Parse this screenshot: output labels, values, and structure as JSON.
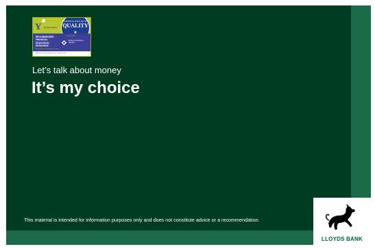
{
  "badge": {
    "brand": "Y",
    "brand_sub": "young money",
    "seal_top": "FINANCIAL EDUCATION",
    "seal_word": "QUALITY",
    "seal_star": "★",
    "recognition": "RECOMMENDED FINANCIAL EDUCATION RESOURCE",
    "assured": "Assured by a Young Money review",
    "supported_by": "Supported by",
    "partner": "Money & Pensions Service",
    "dates": "Award Feb 2024 | Review Date: Jan/Feb 2027"
  },
  "slide": {
    "subtitle": "Let’s talk about money",
    "title": "It’s my choice",
    "disclaimer": "This material is intended for information purposes only and does not constitute advice or a recommendation."
  },
  "logo": {
    "text": "LLOYDS BANK"
  },
  "colors": {
    "background_dark_green": "#003c22",
    "accent_green": "#1c6b48",
    "brand_green": "#00603a",
    "badge_lime": "#b7c62c",
    "badge_blue": "#3b3f96"
  }
}
